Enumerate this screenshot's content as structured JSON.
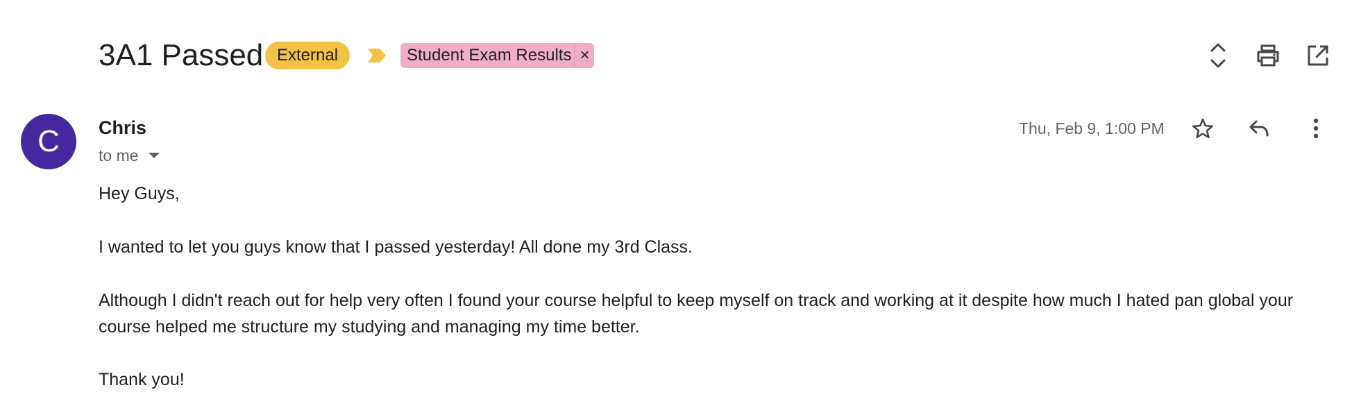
{
  "email": {
    "subject": "3A1 Passed",
    "labels": {
      "external": "External",
      "category": "Student Exam Results",
      "remove_symbol": "×"
    },
    "sender": {
      "avatar_letter": "C",
      "name": "Chris",
      "recipients": "to me"
    },
    "date": "Thu, Feb 9, 1:00 PM",
    "body": {
      "greeting": "Hey Guys,",
      "paragraph1": "I wanted to let you guys know that I passed yesterday! All done my 3rd Class.",
      "paragraph2": "Although I didn't reach out for help very often I found your course helpful to keep myself on track and working at it despite how much I hated pan global your course helped me structure my studying and managing my time better.",
      "closing": "Thank you!"
    }
  },
  "toolbar_icons": [
    "expand-collapse-icon",
    "print-icon",
    "open-in-new-window-icon"
  ],
  "message_icons": [
    "star-icon",
    "reply-icon",
    "more-options-icon"
  ],
  "colors": {
    "external_chip": "#f3c244",
    "importance_marker": "#f3c244",
    "category_chip": "#efaec6",
    "avatar": "#4527a0",
    "secondary_text": "#5f6368",
    "primary_text": "#1f1f1f"
  }
}
